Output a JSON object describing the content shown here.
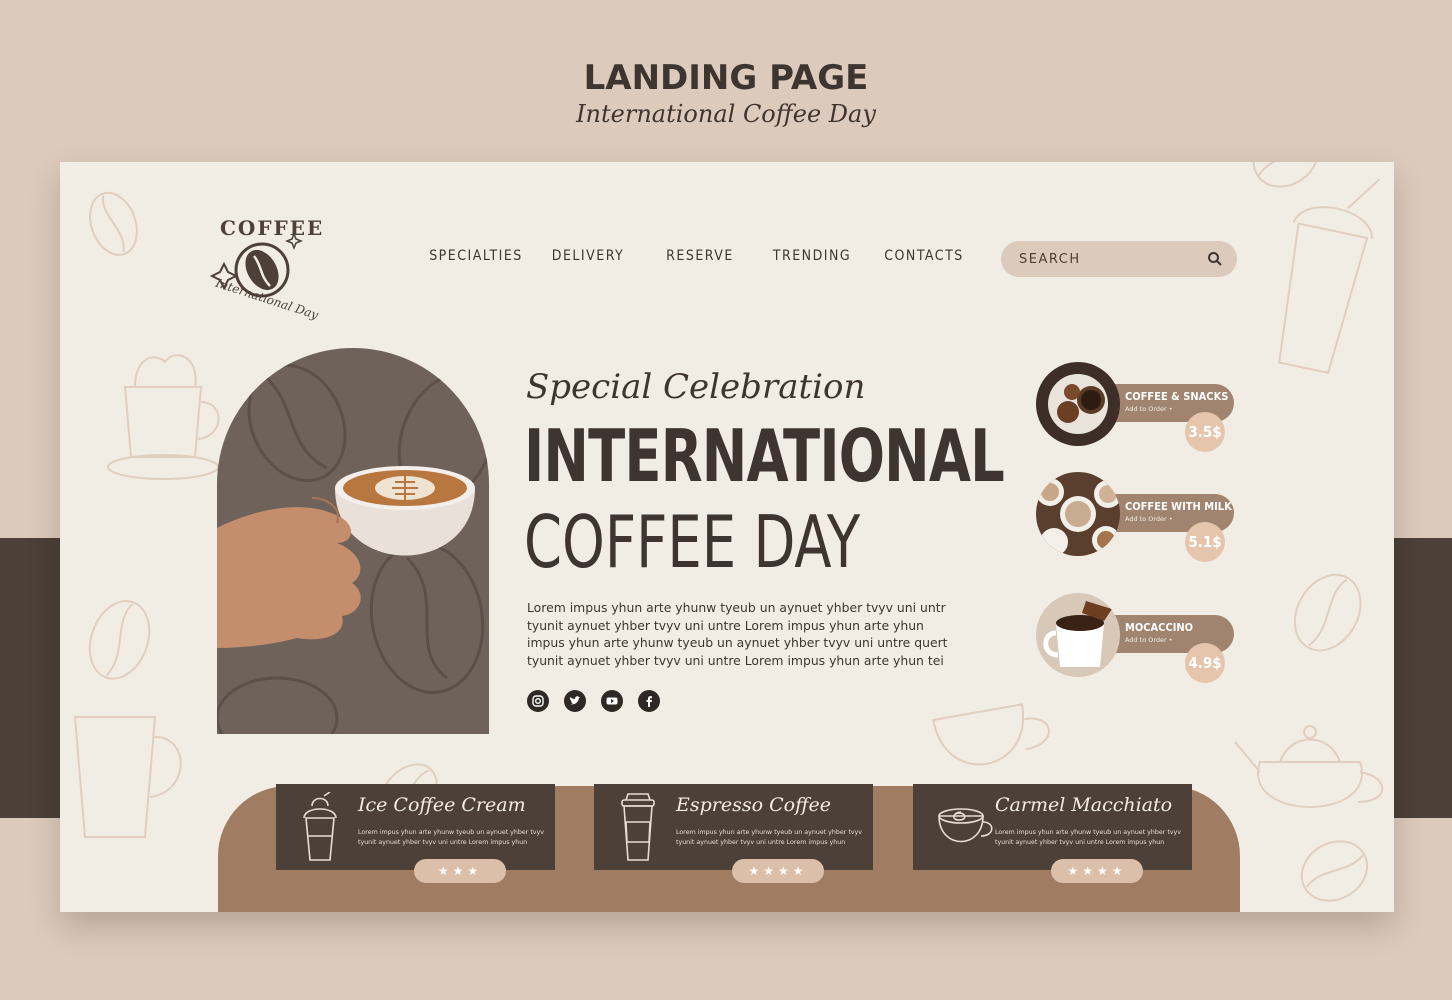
{
  "header": {
    "title": "LANDING PAGE",
    "subtitle": "International Coffee Day"
  },
  "logo": {
    "top_text": "COFFEE",
    "bottom_text": "International Day"
  },
  "nav": {
    "items": [
      "SPECIALTIES",
      "DELIVERY",
      "RESERVE",
      "TRENDING",
      "CONTACTS"
    ]
  },
  "search": {
    "placeholder": "SEARCH"
  },
  "hero": {
    "kicker": "Special Celebration",
    "title_line1": "INTERNATIONAL",
    "title_line2": "COFFEE DAY",
    "body": "Lorem impus yhun arte yhunw tyeub un aynuet yhber tvyv uni untr tyunit aynuet yhber tvyv uni untre Lorem impus yhun arte yhun impus yhun arte yhunw tyeub un aynuet yhber tvyv uni untre quert tyunit aynuet yhber tvyv uni untre Lorem impus yhun arte yhun tei"
  },
  "social": [
    "instagram-icon",
    "twitter-icon",
    "youtube-icon",
    "facebook-icon"
  ],
  "menu": [
    {
      "name": "COFFEE & SNACKS",
      "action": "Add to Order •",
      "price": "3.5$"
    },
    {
      "name": "COFFEE WITH MILK",
      "action": "Add to Order •",
      "price": "5.1$"
    },
    {
      "name": "MOCACCINO",
      "action": "Add to Order •",
      "price": "4.9$"
    }
  ],
  "products": [
    {
      "title": "Ice Coffee Cream",
      "desc": "Lorem impus yhun arte yhunw tyeub un aynuet yhber tvyv tyunit aynuet yhber tvyv uni untre Lorem impus yhun",
      "stars": "★★★",
      "rating": 3,
      "icon": "iced-coffee-icon"
    },
    {
      "title": "Espresso Coffee",
      "desc": "Lorem impus yhun arte yhunw tyeub un aynuet yhber tvyv tyunit aynuet yhber tvyv uni untre Lorem impus yhun",
      "stars": "★★★★",
      "rating": 4,
      "icon": "takeaway-cup-icon"
    },
    {
      "title": "Carmel Macchiato",
      "desc": "Lorem impus yhun arte yhunw tyeub un aynuet yhber tvyv tyunit aynuet yhber tvyv uni untre Lorem impus yhun",
      "stars": "★★★★",
      "rating": 4,
      "icon": "coffee-cup-icon"
    }
  ],
  "colors": {
    "background": "#dccabc",
    "dark_band": "#4c4038",
    "page": "#f2ede4",
    "text_dark": "#3f3530",
    "accent_brown": "#a07c62",
    "price_badge": "#e5c6ad"
  }
}
